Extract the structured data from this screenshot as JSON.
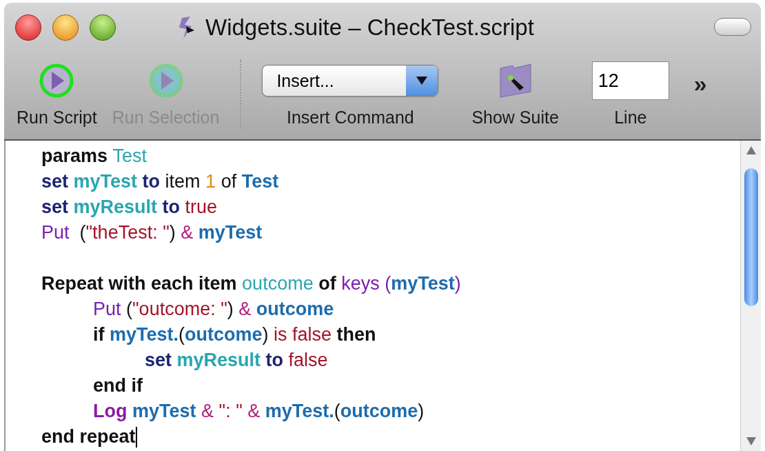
{
  "window": {
    "title": "Widgets.suite – CheckTest.script"
  },
  "toolbar": [
    {
      "kind": "run",
      "label": "Run Script",
      "disabled": false
    },
    {
      "kind": "run-selection",
      "label": "Run Selection",
      "disabled": true
    },
    {
      "kind": "popup",
      "label": "Insert Command",
      "value": "Insert..."
    },
    {
      "kind": "suite",
      "label": "Show Suite",
      "disabled": false
    },
    {
      "kind": "field",
      "label": "Line",
      "value": "12"
    }
  ],
  "overflow": "»",
  "editor": {
    "lines": [
      {
        "kind": "code",
        "tokens": [
          {
            "t": "params ",
            "kind": "command"
          },
          {
            "t": "Test",
            "kind": "param"
          }
        ]
      },
      {
        "kind": "code",
        "tokens": [
          {
            "t": "set ",
            "kind": "keyword"
          },
          {
            "t": "myTest ",
            "kind": "var"
          },
          {
            "t": "to ",
            "kind": "keyword"
          },
          {
            "t": "item ",
            "kind": "plain"
          },
          {
            "t": "1 ",
            "kind": "number"
          },
          {
            "t": "of ",
            "kind": "plain"
          },
          {
            "t": "Test",
            "kind": "ref"
          }
        ]
      },
      {
        "kind": "code",
        "tokens": [
          {
            "t": "set ",
            "kind": "keyword"
          },
          {
            "t": "myResult ",
            "kind": "var"
          },
          {
            "t": "to ",
            "kind": "keyword"
          },
          {
            "t": "true",
            "kind": "value"
          }
        ]
      },
      {
        "kind": "code",
        "tokens": [
          {
            "t": "Put  ",
            "kind": "func"
          },
          {
            "t": "(",
            "kind": "paren"
          },
          {
            "t": "\"theTest: \"",
            "kind": "value"
          },
          {
            "t": ") ",
            "kind": "paren"
          },
          {
            "t": "& ",
            "kind": "op"
          },
          {
            "t": "myTest",
            "kind": "ref"
          }
        ]
      },
      {
        "kind": "blank"
      },
      {
        "kind": "code",
        "tokens": [
          {
            "t": "Repeat with each item ",
            "kind": "command"
          },
          {
            "t": "outcome ",
            "kind": "param"
          },
          {
            "t": "of ",
            "kind": "command"
          },
          {
            "t": "keys ",
            "kind": "func"
          },
          {
            "t": "(",
            "kind": "func"
          },
          {
            "t": "myTest",
            "kind": "ref"
          },
          {
            "t": ")",
            "kind": "func"
          }
        ],
        "children": [
          {
            "kind": "code",
            "tokens": [
              {
                "t": "Put ",
                "kind": "func"
              },
              {
                "t": "(",
                "kind": "paren"
              },
              {
                "t": "\"outcome: \"",
                "kind": "value"
              },
              {
                "t": ") ",
                "kind": "paren"
              },
              {
                "t": "& ",
                "kind": "op"
              },
              {
                "t": "outcome",
                "kind": "ref"
              }
            ]
          },
          {
            "kind": "code",
            "tokens": [
              {
                "t": "if ",
                "kind": "command"
              },
              {
                "t": "myTest.",
                "kind": "ref"
              },
              {
                "t": "(",
                "kind": "paren"
              },
              {
                "t": "outcome",
                "kind": "ref"
              },
              {
                "t": ") ",
                "kind": "paren"
              },
              {
                "t": "is false ",
                "kind": "value"
              },
              {
                "t": "then",
                "kind": "command"
              }
            ],
            "children": [
              {
                "kind": "code",
                "tokens": [
                  {
                    "t": "set ",
                    "kind": "keyword"
                  },
                  {
                    "t": "myResult ",
                    "kind": "var"
                  },
                  {
                    "t": "to ",
                    "kind": "keyword"
                  },
                  {
                    "t": "false",
                    "kind": "value"
                  }
                ]
              }
            ]
          },
          {
            "kind": "code",
            "tokens": [
              {
                "t": "end if",
                "kind": "command"
              }
            ]
          },
          {
            "kind": "code",
            "tokens": [
              {
                "t": "Log ",
                "kind": "log"
              },
              {
                "t": "myTest ",
                "kind": "ref"
              },
              {
                "t": "& ",
                "kind": "op"
              },
              {
                "t": "\": \" ",
                "kind": "value"
              },
              {
                "t": "& ",
                "kind": "op"
              },
              {
                "t": "myTest.",
                "kind": "ref"
              },
              {
                "t": "(",
                "kind": "paren"
              },
              {
                "t": "outcome",
                "kind": "ref"
              },
              {
                "t": ")",
                "kind": "paren"
              }
            ]
          }
        ]
      },
      {
        "kind": "code",
        "cursor": true,
        "tokens": [
          {
            "t": "end repeat",
            "kind": "command"
          }
        ]
      }
    ]
  }
}
